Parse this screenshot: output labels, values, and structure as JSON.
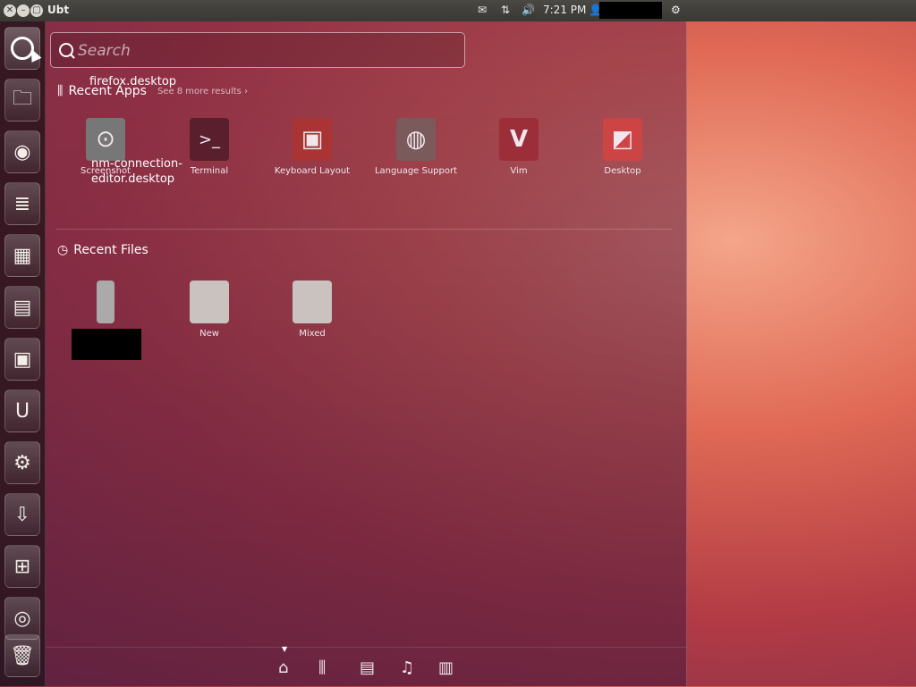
{
  "top_panel": {
    "app_title": "Ubt",
    "time": "7:21 PM",
    "icons": [
      "close-icon",
      "minimize-icon",
      "maximize-icon",
      "mail-icon",
      "network-icon",
      "volume-icon",
      "user-icon",
      "session-gear-icon"
    ]
  },
  "launcher": {
    "items": [
      {
        "name": "dash-home",
        "glyph": "◯"
      },
      {
        "name": "files",
        "glyph": "🗀"
      },
      {
        "name": "firefox",
        "glyph": "◉"
      },
      {
        "name": "writer",
        "glyph": "≣"
      },
      {
        "name": "calc",
        "glyph": "▦"
      },
      {
        "name": "impress",
        "glyph": "▤"
      },
      {
        "name": "software-center",
        "glyph": "🛍"
      },
      {
        "name": "ubuntu-one",
        "glyph": "U"
      },
      {
        "name": "system-settings",
        "glyph": "⚙"
      },
      {
        "name": "update-manager",
        "glyph": "⇩"
      },
      {
        "name": "workspace-switcher",
        "glyph": "⊞"
      },
      {
        "name": "cdrom",
        "glyph": "◎"
      },
      {
        "name": "trash",
        "glyph": "🗑"
      }
    ]
  },
  "search": {
    "placeholder": "Search",
    "value": ""
  },
  "recent_apps": {
    "heading": "Recent Apps",
    "more": "See 8 more results ›",
    "apps": [
      {
        "label": "Screenshot",
        "glyph": "⊙",
        "color": "#777"
      },
      {
        "label": "Terminal",
        "glyph": "▸_",
        "color": "#5a1f2c"
      },
      {
        "label": "Keyboard Layout",
        "glyph": "▣",
        "color": "#a33"
      },
      {
        "label": "Language Support",
        "glyph": "◍",
        "color": "#7a5a5a"
      },
      {
        "label": "Vim",
        "glyph": "V",
        "color": "#9c2e3a"
      },
      {
        "label": "Desktop",
        "glyph": "◩",
        "color": "#c44"
      }
    ]
  },
  "overlay_labels": {
    "firefox": "firefox.desktop",
    "nm_line1": "nm-connection-",
    "nm_line2": "editor.desktop"
  },
  "recent_files": {
    "heading": "Recent Files",
    "files": [
      {
        "label": "",
        "glyph": "▮"
      },
      {
        "label": "New",
        "glyph": "🗀"
      },
      {
        "label": "Mixed",
        "glyph": "🗀"
      }
    ]
  },
  "filters": [
    "home-lens",
    "apps-lens",
    "files-lens",
    "music-lens",
    "video-lens"
  ]
}
